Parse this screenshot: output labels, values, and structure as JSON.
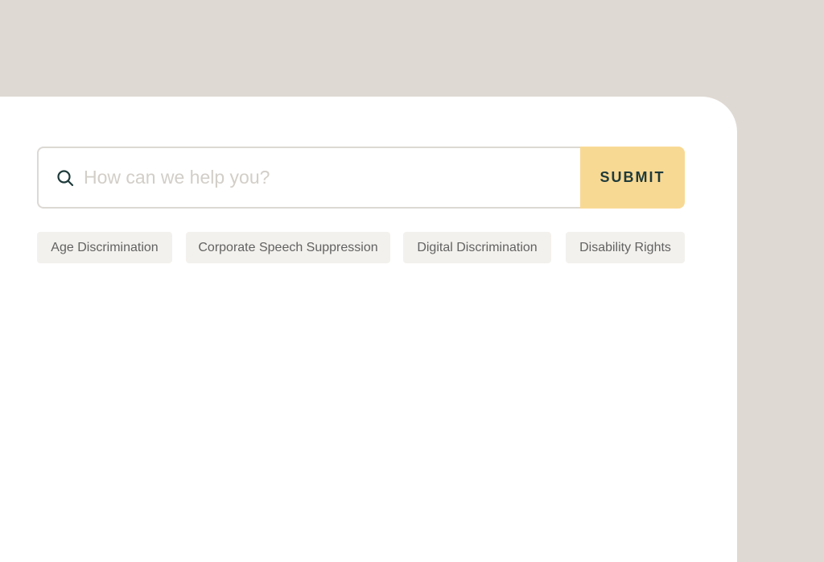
{
  "search": {
    "placeholder": "How can we help you?",
    "value": "",
    "icon": "search-icon",
    "submit_label": "SUBMIT"
  },
  "tags": [
    {
      "label": "Age Discrimination"
    },
    {
      "label": "Corporate Speech Suppression"
    },
    {
      "label": "Digital Discrimination"
    },
    {
      "label": "Disability Rights"
    }
  ],
  "colors": {
    "page_background": "#dfd9d3",
    "panel_background": "#ffffff",
    "submit_background": "#f8d994",
    "submit_text": "#1e3a3a",
    "tag_background": "#f3f1ed",
    "tag_text": "#626262",
    "placeholder_text": "#d2cec8",
    "icon_color": "#1e3a3a"
  }
}
